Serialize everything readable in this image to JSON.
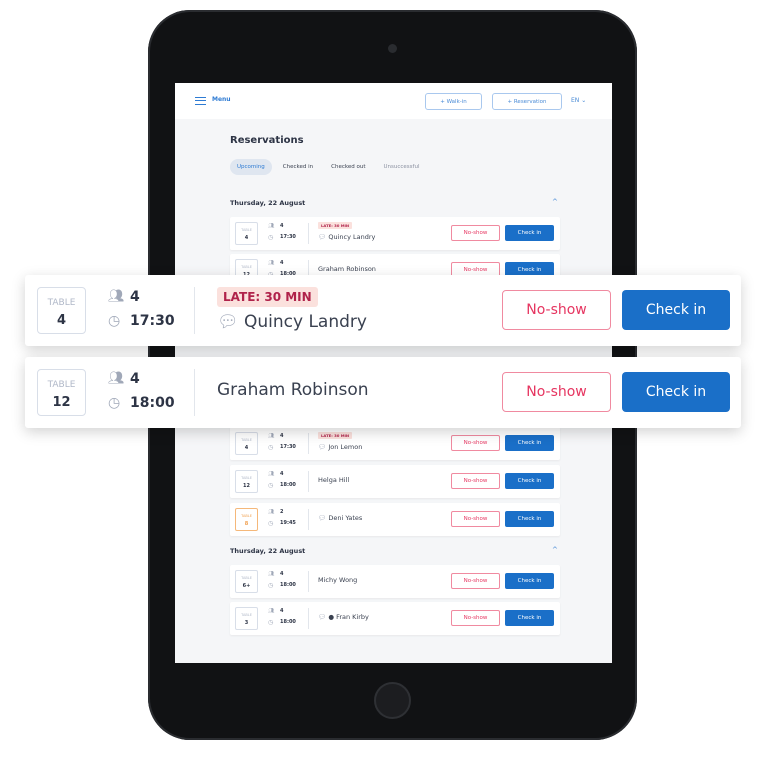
{
  "header": {
    "menu_label": "Menu",
    "walkin_label": "+  Walk-in",
    "reservation_label": "+  Reservation",
    "language": "EN"
  },
  "page": {
    "title": "Reservations",
    "tabs": [
      {
        "label": "Upcoming",
        "active": true
      },
      {
        "label": "Checked in"
      },
      {
        "label": "Checked out"
      },
      {
        "label": "Unsuccessful"
      }
    ]
  },
  "labels": {
    "table": "TABLE",
    "no_show": "No-show",
    "check_in": "Check in"
  },
  "colors": {
    "accent": "#1a6fc8",
    "danger": "#e63560",
    "late_bg": "#fbe1dd",
    "warning": "#f0a050"
  },
  "sections": [
    {
      "date": "Thursday, 22 August",
      "rows": [
        {
          "table": "4",
          "guests": "4",
          "time": "17:30",
          "late": "LATE: 30 MIN",
          "name": "Quincy Landry",
          "note": true
        },
        {
          "table": "12",
          "guests": "4",
          "time": "18:00",
          "name": "Graham Robinson"
        }
      ]
    },
    {
      "rows": [
        {
          "table": "4",
          "guests": "4",
          "time": "17:30",
          "late": "LATE: 30 MIN",
          "name": "Jon Lemon",
          "note": true
        },
        {
          "table": "12",
          "guests": "4",
          "time": "18:00",
          "name": "Helga Hill"
        },
        {
          "table": "8",
          "guests": "2",
          "time": "19:45",
          "name": "Deni Yates",
          "note": true,
          "highlight": "orange"
        }
      ]
    },
    {
      "date": "Thursday, 22 August",
      "rows": [
        {
          "table": "6+",
          "guests": "4",
          "time": "18:00",
          "name": "Michy Wong"
        },
        {
          "table": "3",
          "guests": "4",
          "time": "18:00",
          "name": "Fran Kirby",
          "note": true,
          "vip": true
        }
      ]
    }
  ],
  "featured": [
    {
      "table": "4",
      "guests": "4",
      "time": "17:30",
      "late": "LATE: 30 MIN",
      "name": "Quincy Landry",
      "note": true
    },
    {
      "table": "12",
      "guests": "4",
      "time": "18:00",
      "name": "Graham Robinson"
    }
  ]
}
